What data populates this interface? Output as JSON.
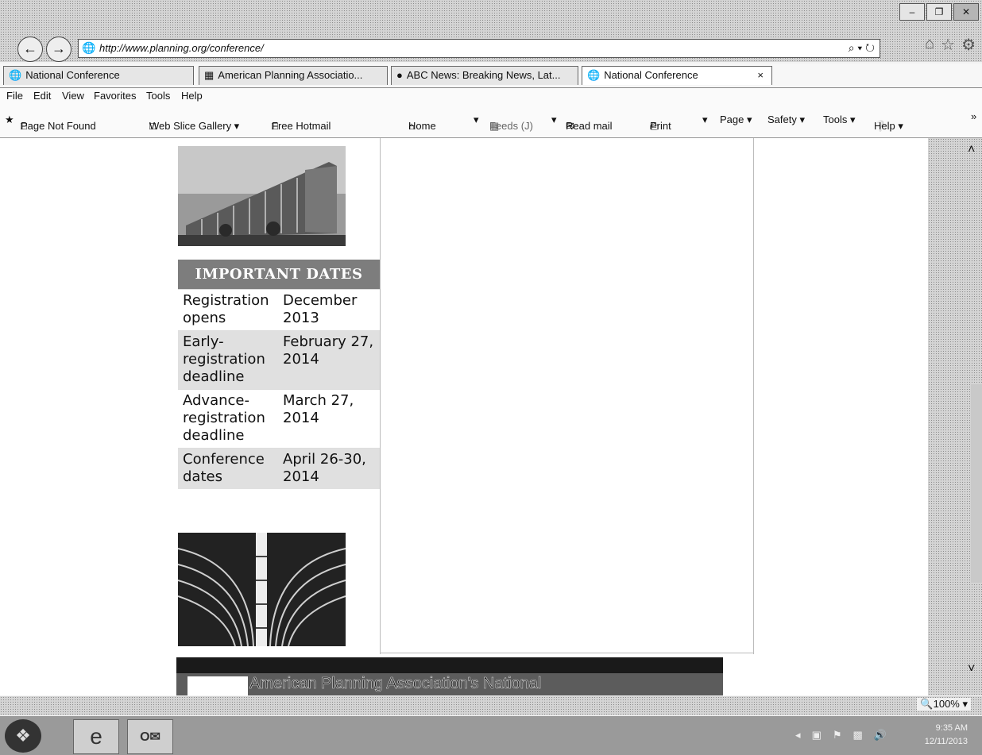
{
  "window": {
    "controls": [
      "–",
      "❐",
      "✕"
    ]
  },
  "nav": {
    "back_icon": "back-arrow-icon",
    "forward_icon": "forward-arrow-icon",
    "url": "http://www.planning.org/conference/",
    "search_glyph": "⌕ ▾ ↻"
  },
  "tabs": [
    {
      "label": "National Conference",
      "icon": "globe-icon"
    },
    {
      "label": "American Planning Associatio...",
      "icon": "apa-icon"
    },
    {
      "label": "ABC News: Breaking News, Lat...",
      "icon": "abc-icon"
    },
    {
      "label": "National Conference",
      "icon": "globe-icon",
      "active": true,
      "close": "×"
    }
  ],
  "menu": [
    "File",
    "Edit",
    "View",
    "Favorites",
    "Tools",
    "Help"
  ],
  "favorites_bar": [
    "Page Not Found",
    "Web Slice Gallery ▾",
    "Free Hotmail"
  ],
  "command_bar": [
    "Home",
    "▾",
    "Feeds (J)",
    "▾",
    "Read mail",
    "Print",
    "▾",
    "Page ▾",
    "Safety ▾",
    "Tools ▾",
    "Help ▾"
  ],
  "page": {
    "dates_heading": "IMPORTANT DATES",
    "dates": [
      {
        "label": "Registration opens",
        "value": "December 2013"
      },
      {
        "label": "Early-registration deadline",
        "value": "February 27, 2014"
      },
      {
        "label": "Advance-registration deadline",
        "value": "March 27, 2014"
      },
      {
        "label": "Conference dates",
        "value": "April 26-30, 2014"
      }
    ],
    "banner_text": "American Planning Association's National"
  },
  "status": {
    "zoom": "100%"
  },
  "taskbar": {
    "clock_time": "9:35 AM",
    "clock_date": "12/11/2013"
  }
}
